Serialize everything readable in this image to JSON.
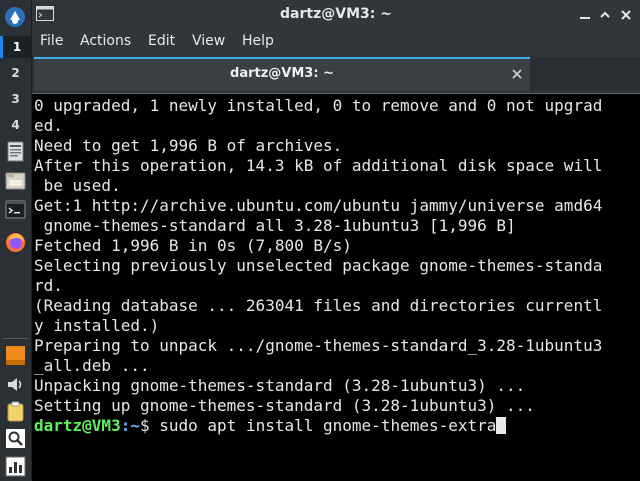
{
  "dock": {
    "workspaces": [
      "1",
      "2",
      "3",
      "4"
    ],
    "active_workspace": "1",
    "icons": [
      "start-menu-icon",
      "text-editor-icon",
      "file-manager-icon",
      "terminal-icon",
      "firefox-icon",
      "package-icon",
      "volume-icon",
      "clipboard-icon",
      "search-icon",
      "task-manager-icon"
    ]
  },
  "window": {
    "title": "dartz@VM3: ~",
    "menu": [
      "File",
      "Actions",
      "Edit",
      "View",
      "Help"
    ],
    "tab_label": "dartz@VM3: ~"
  },
  "terminal": {
    "lines": [
      "0 upgraded, 1 newly installed, 0 to remove and 0 not upgrad",
      "ed.",
      "Need to get 1,996 B of archives.",
      "After this operation, 14.3 kB of additional disk space will",
      " be used.",
      "Get:1 http://archive.ubuntu.com/ubuntu jammy/universe amd64",
      " gnome-themes-standard all 3.28-1ubuntu3 [1,996 B]",
      "Fetched 1,996 B in 0s (7,800 B/s)",
      "Selecting previously unselected package gnome-themes-standa",
      "rd.",
      "(Reading database ... 263041 files and directories currentl",
      "y installed.)",
      "Preparing to unpack .../gnome-themes-standard_3.28-1ubuntu3",
      "_all.deb ...",
      "Unpacking gnome-themes-standard (3.28-1ubuntu3) ...",
      "Setting up gnome-themes-standard (3.28-1ubuntu3) ..."
    ],
    "prompt_user": "dartz@VM3",
    "prompt_sep": ":",
    "prompt_path": "~",
    "prompt_symbol": "$",
    "command": " sudo apt install gnome-themes-extra"
  },
  "colors": {
    "accent": "#3daee9",
    "terminal_bg": "#000000",
    "prompt_user": "#5ff05f",
    "prompt_path": "#6bb2ff"
  }
}
